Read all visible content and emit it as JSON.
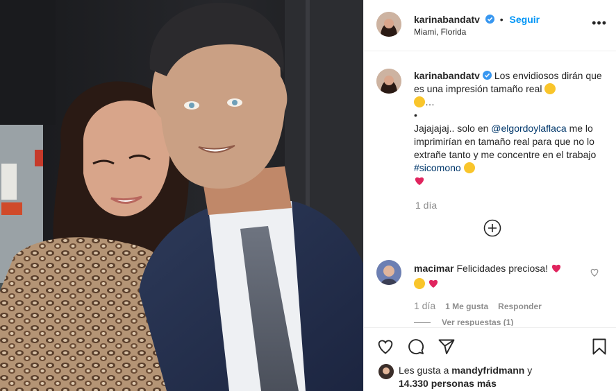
{
  "post": {
    "author": "karinabandatv",
    "follow_label": "Seguir",
    "location": "Miami, Florida",
    "more_label": "•••"
  },
  "caption": {
    "author": "karinabandatv",
    "text_1": "Los envidiosos dirán que es una impresión tamaño real",
    "ellipsis": "…",
    "bullet": "•",
    "text_2": "Jajajajaj.. solo en",
    "mention": "@elgordoylaflaca",
    "text_3": "me lo imprimirían en tamaño real para que no lo extrañe tanto y me concentre en el trabajo",
    "hashtag": "#sicomono",
    "time": "1 día"
  },
  "comment": {
    "author": "macimar",
    "text": "Felicidades preciosa!",
    "time": "1 día",
    "likes": "1 Me gusta",
    "reply_label": "Responder",
    "view_replies": "Ver respuestas (1)"
  },
  "likes": {
    "prefix": "Les gusta a",
    "user": "mandyfridmann",
    "joiner": "y",
    "others": "14.330 personas más"
  },
  "icons": {
    "like": "heart-icon",
    "comment": "comment-icon",
    "share": "paper-plane-icon",
    "save": "bookmark-icon",
    "load_more": "plus-circle-icon",
    "verified": "verified-badge-icon"
  },
  "colors": {
    "link": "#00376b",
    "follow": "#0095f6",
    "muted": "#8e8e8e",
    "verified": "#3897f0"
  }
}
